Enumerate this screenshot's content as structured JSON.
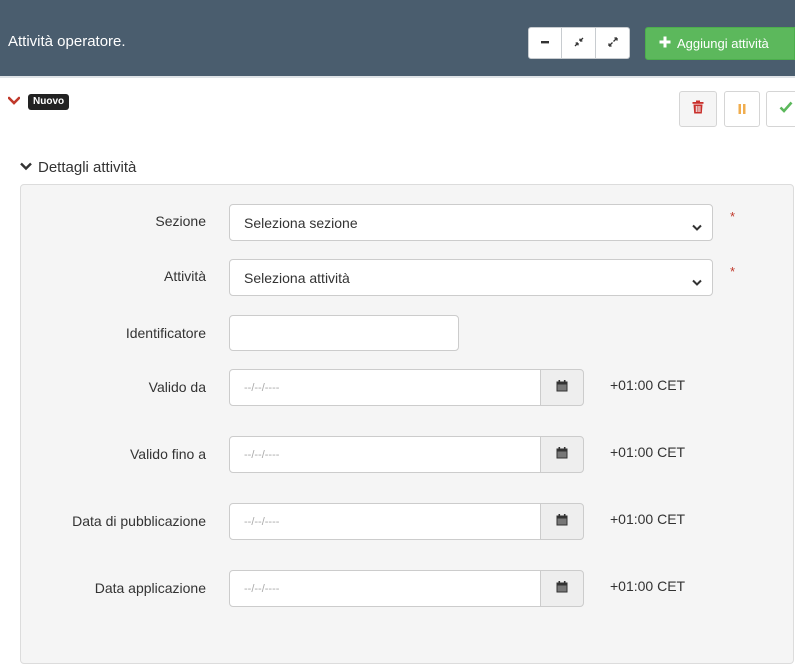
{
  "header": {
    "title": "Attività operatore.",
    "buttons": {
      "minimize_icon": "minus-icon",
      "collapse_icon": "compress-icon",
      "expand_icon": "expand-icon",
      "add_label": "Aggiungi attività",
      "add_icon": "plus-icon"
    }
  },
  "record": {
    "badge": "Nuovo",
    "actions": {
      "delete_icon": "trash-icon",
      "pause_icon": "pause-icon",
      "confirm_icon": "check-icon"
    }
  },
  "section": {
    "title": "Dettagli attività",
    "fields": {
      "sezione": {
        "label": "Sezione",
        "value": "Seleziona sezione",
        "required_mark": "*"
      },
      "attivita": {
        "label": "Attività",
        "value": "Seleziona attività",
        "required_mark": "*"
      },
      "identificatore": {
        "label": "Identificatore",
        "value": ""
      },
      "valido_da": {
        "label": "Valido da",
        "placeholder": "--/--/----",
        "timezone": "+01:00 CET"
      },
      "valido_fino_a": {
        "label": "Valido fino a",
        "placeholder": "--/--/----",
        "timezone": "+01:00 CET"
      },
      "data_pubblicazione": {
        "label": "Data di pubblicazione",
        "placeholder": "--/--/----",
        "timezone": "+01:00 CET"
      },
      "data_applicazione": {
        "label": "Data applicazione",
        "placeholder": "--/--/----",
        "timezone": "+01:00 CET"
      }
    }
  },
  "colors": {
    "header_bg": "#4a5d6e",
    "success": "#5cb85c",
    "danger": "#c9302c",
    "warning": "#f0ad4e",
    "panel_bg": "#f5f5f5"
  }
}
